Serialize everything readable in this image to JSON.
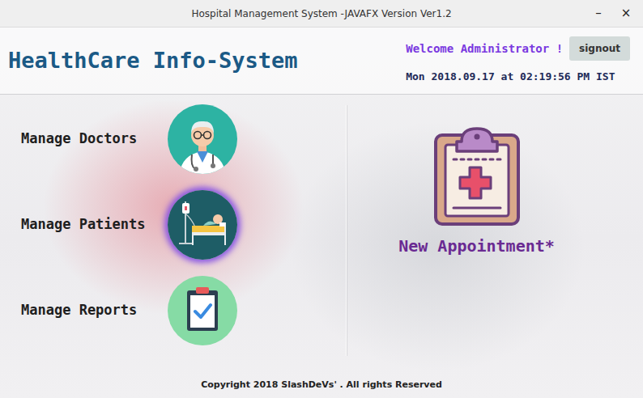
{
  "window": {
    "title": "Hospital Management System -JAVAFX Version Ver1.2",
    "controls": [
      "–",
      "×"
    ]
  },
  "header": {
    "app_title": "HealthCare Info-System",
    "welcome": "Welcome Administrator !",
    "signout": "signout",
    "datetime": "Mon 2018.09.17 at 02:19:56 PM IST"
  },
  "menu": [
    {
      "label": "Manage Doctors",
      "selected": false
    },
    {
      "label": "Manage Patients",
      "selected": true
    },
    {
      "label": "Manage Reports",
      "selected": false
    }
  ],
  "appointment": {
    "label": "New Appointment*"
  },
  "footer": {
    "copyright": "Copyright 2018 SlashDeVs' . All rights Reserved"
  }
}
